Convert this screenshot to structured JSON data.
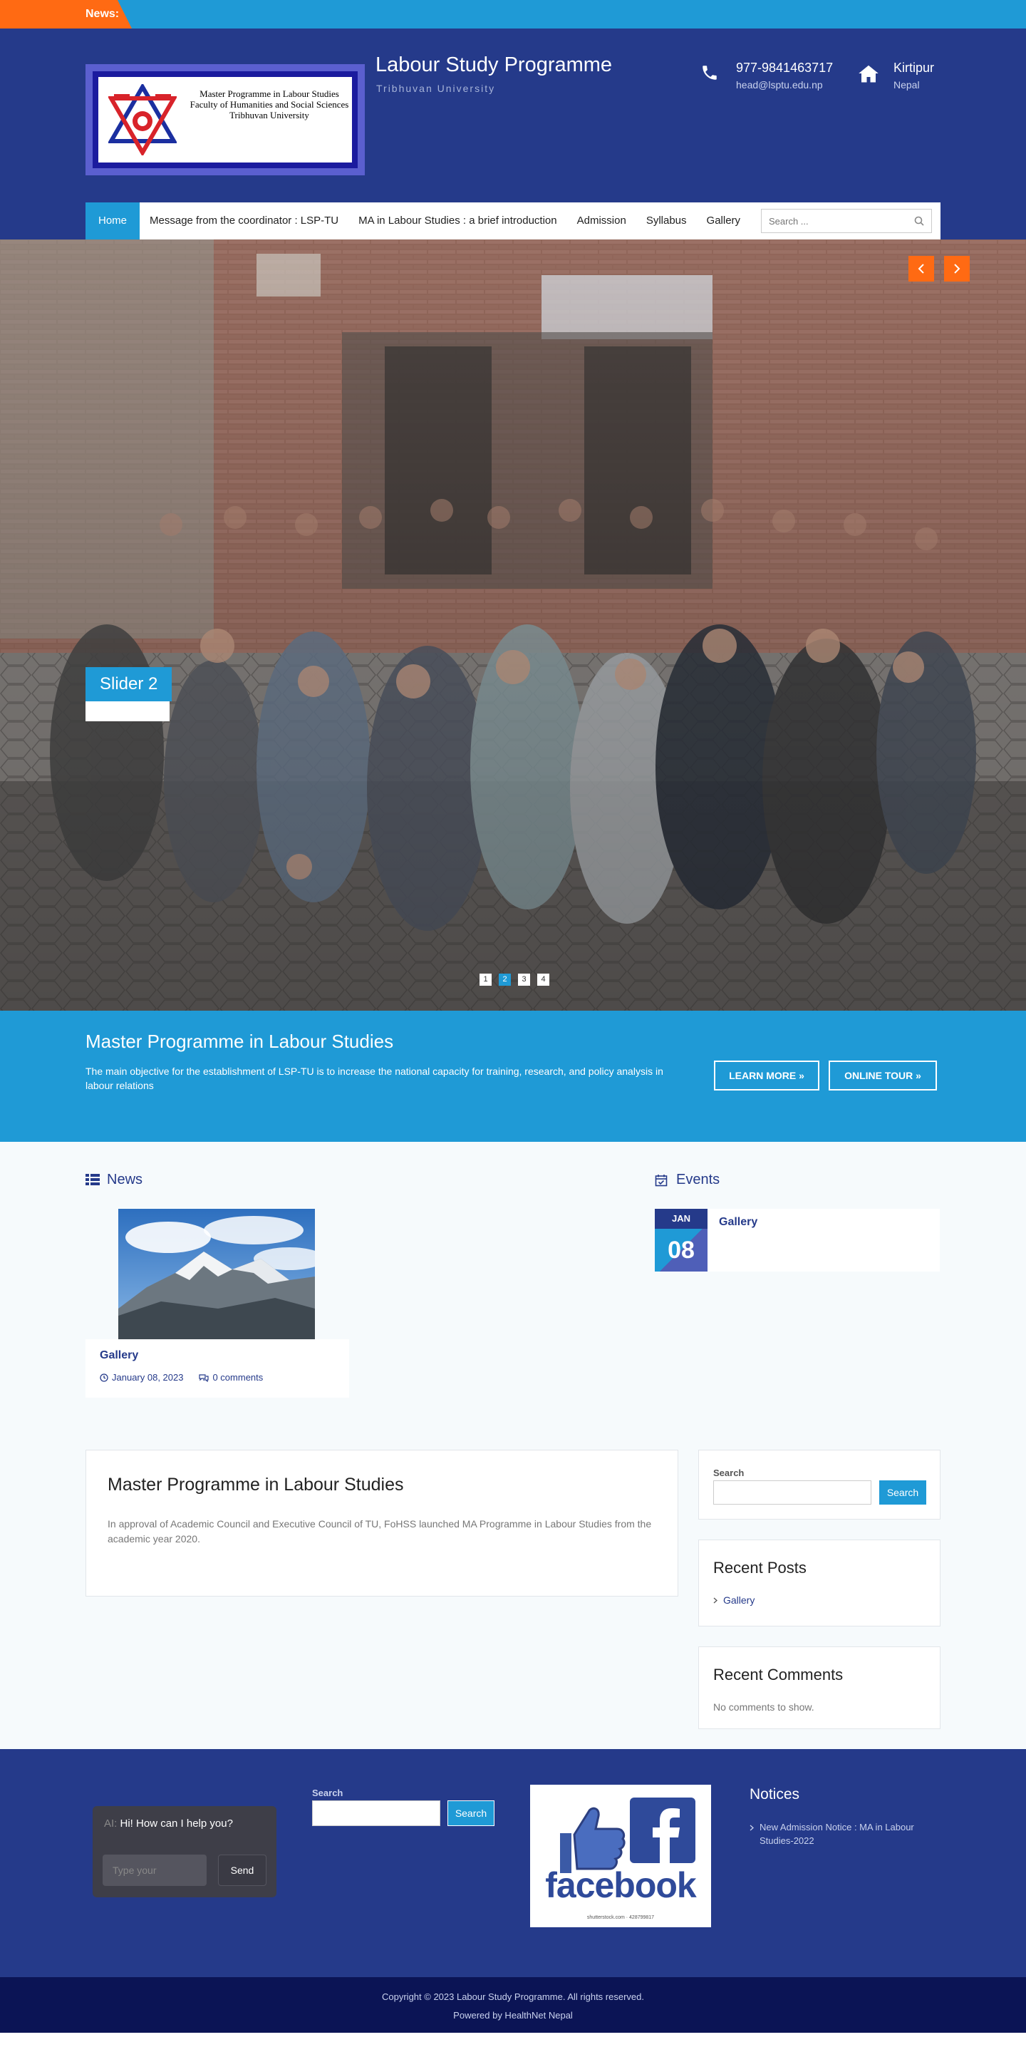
{
  "ticker": {
    "label": "News:"
  },
  "header": {
    "logo_text": [
      "Master Programme in Labour Studies",
      "Faculty of Humanities and Social Sciences",
      "Tribhuvan University"
    ],
    "title": "Labour Study Programme",
    "subtitle": "Tribhuvan University",
    "phone": "977-9841463717",
    "email": "head@lsptu.edu.np",
    "location": "Kirtipur",
    "country": "Nepal"
  },
  "nav": {
    "items": [
      "Home",
      "Message from the coordinator : LSP-TU",
      "MA in Labour Studies : a brief introduction",
      "Admission",
      "Syllabus",
      "Gallery"
    ],
    "search_placeholder": "Search ..."
  },
  "hero": {
    "slide_title": "Slider 2",
    "dots": [
      "1",
      "2",
      "3",
      "4"
    ],
    "active_dot": 2
  },
  "cta": {
    "title": "Master Programme in Labour Studies",
    "text": "The main objective for the establishment of LSP-TU is to increase the national capacity for training, research, and policy analysis in labour relations",
    "learn_more": "LEARN MORE »",
    "online_tour": "ONLINE TOUR »"
  },
  "news": {
    "heading": "News",
    "item_title": "Gallery",
    "date": "January 08, 2023",
    "comments": "0 comments"
  },
  "events": {
    "heading": "Events",
    "month": "JAN",
    "day": "08",
    "title": "Gallery"
  },
  "article": {
    "title": "Master Programme in Labour Studies",
    "body": "In approval of Academic Council and Executive Council of TU, FoHSS launched MA Programme in Labour Studies from the academic year 2020."
  },
  "sidebar": {
    "search_label": "Search",
    "search_button": "Search",
    "recent_posts_title": "Recent Posts",
    "recent_post": "Gallery",
    "recent_comments_title": "Recent Comments",
    "no_comments": "No comments to show."
  },
  "footer": {
    "chat_ai": "AI:",
    "chat_greeting": "Hi! How can I help you?",
    "chat_placeholder": "Type your",
    "chat_send": "Send",
    "search_label": "Search",
    "search_button": "Search",
    "fb_word": "facebook",
    "fb_credit": "shutterstock.com · 428799817",
    "notices_title": "Notices",
    "notice": "New Admission Notice : MA in Labour Studies-2022",
    "copyright": "Copyright © 2023 Labour Study Programme. All rights reserved.",
    "powered": "Powered by HealthNet Nepal"
  },
  "colors": {
    "primary": "#253a8a",
    "accent": "#1f9ad6",
    "orange": "#ff6a13"
  }
}
